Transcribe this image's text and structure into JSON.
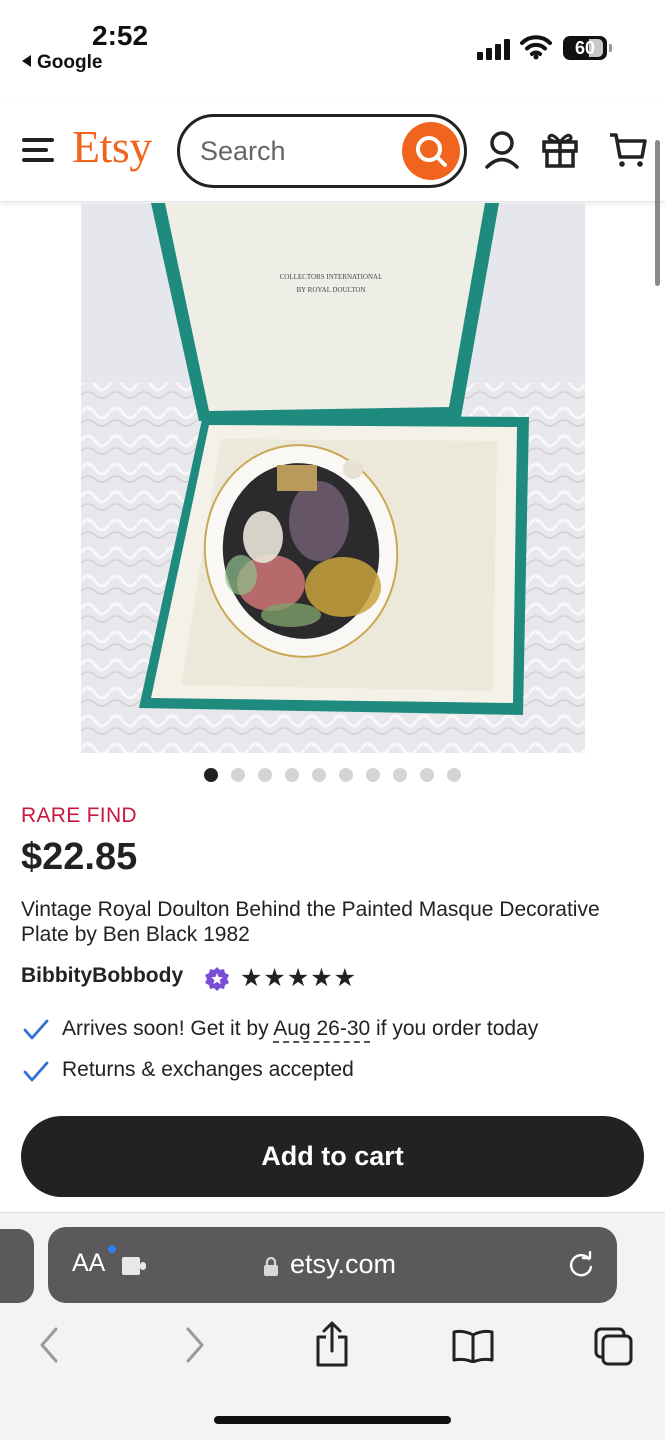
{
  "status_bar": {
    "time": "2:52",
    "back_label": "Google",
    "battery": "60"
  },
  "header": {
    "logo": "Etsy",
    "search_placeholder": "Search"
  },
  "listing": {
    "image_count": 10,
    "active_image_index": 0,
    "photo_box_text_line1": "COLLECTORS INTERNATIONAL",
    "photo_box_text_line2": "BY ROYAL DOULTON",
    "badge": "RARE FIND",
    "price": "$22.85",
    "title": "Vintage Royal Doulton Behind the Painted Masque Decorative Plate by Ben Black 1982",
    "shop_name": "BibbityBobbody",
    "rating_stars": "★★★★★",
    "rating_value": 5,
    "features": [
      {
        "text_before": "Arrives soon! Get it by ",
        "date": "Aug 26-30",
        "text_after": " if you order today"
      },
      {
        "text": "Returns & exchanges accepted"
      }
    ],
    "add_to_cart": "Add to cart"
  },
  "browser": {
    "aa_label": "AA",
    "domain": "etsy.com"
  },
  "colors": {
    "brand": "#f1641e",
    "badge": "#c9173e",
    "check": "#2f6fd6",
    "star_seller": "#7a4dd6"
  }
}
